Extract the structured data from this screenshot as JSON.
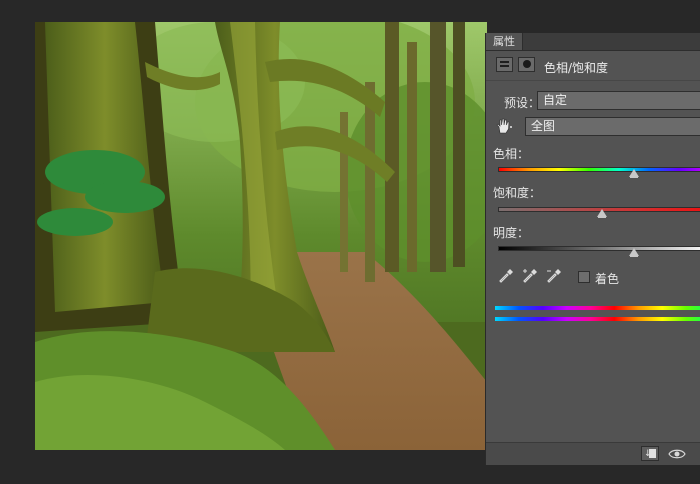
{
  "panel": {
    "tab_label": "属性",
    "adjustment_title": "色相/饱和度",
    "preset_label": "预设：",
    "preset_value": "自定",
    "channel_value": "全图",
    "hue_label": "色相：",
    "saturation_label": "饱和度：",
    "lightness_label": "明度：",
    "colorize_label": "着色",
    "colorize_checked": false,
    "hue_slider_position": 0.65,
    "saturation_slider_position": 0.5,
    "lightness_slider_position": 0.65
  },
  "icons": {
    "adjustment_layer": "hue-saturation-icon",
    "mask": "mask-icon",
    "hand": "hand-icon",
    "eyedropper": "eyedropper-icon",
    "eyedropper_add": "eyedropper-plus-icon",
    "eyedropper_subtract": "eyedropper-minus-icon",
    "clip": "clip-to-layer-icon",
    "visibility": "eye-icon"
  },
  "colors": {
    "app_background": "#282828",
    "panel_background": "#535353",
    "control_background": "#6b6b6b"
  }
}
